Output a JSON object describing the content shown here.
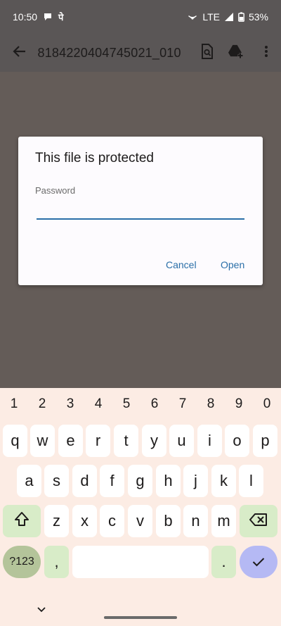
{
  "status_bar": {
    "time": "10:50",
    "carrier_glyph": "पे",
    "network": "LTE",
    "battery": "53%"
  },
  "app_bar": {
    "file_title": "8184220404745021_010..."
  },
  "dialog": {
    "title": "This file is protected",
    "password_label": "Password",
    "password_value": "",
    "cancel_label": "Cancel",
    "open_label": "Open"
  },
  "keyboard": {
    "number_row": [
      "1",
      "2",
      "3",
      "4",
      "5",
      "6",
      "7",
      "8",
      "9",
      "0"
    ],
    "row1": [
      "q",
      "w",
      "e",
      "r",
      "t",
      "y",
      "u",
      "i",
      "o",
      "p"
    ],
    "row2": [
      "a",
      "s",
      "d",
      "f",
      "g",
      "h",
      "j",
      "k",
      "l"
    ],
    "row3": [
      "z",
      "x",
      "c",
      "v",
      "b",
      "n",
      "m"
    ],
    "symbols_label": "?123",
    "comma_label": ",",
    "period_label": "."
  },
  "colors": {
    "accent": "#2a6fa8",
    "scrim": "#645c58",
    "keyboard_bg": "#fcece4",
    "function_key": "#d8ecc8",
    "enter_key": "#b5b9f4"
  }
}
